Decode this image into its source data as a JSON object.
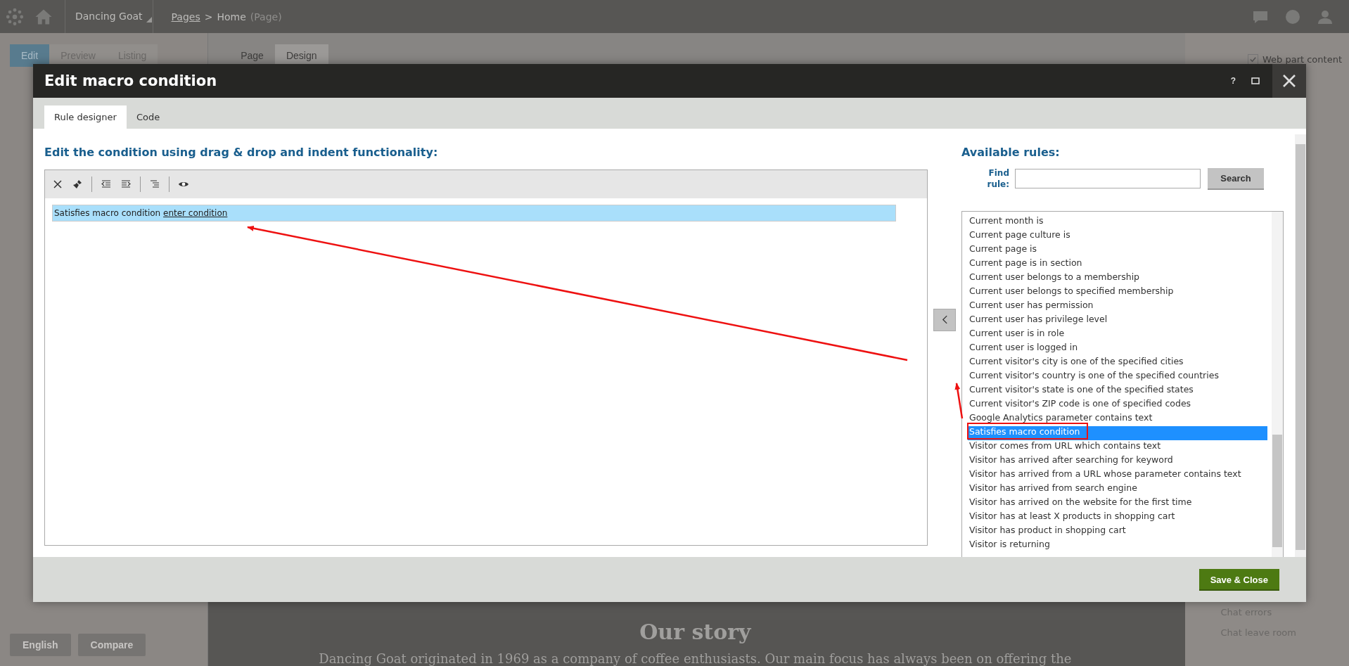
{
  "top_bar": {
    "site": "Dancing Goat",
    "breadcrumb_link": "Pages",
    "breadcrumb_separator": ">",
    "page": "Home",
    "page_type": "(Page)"
  },
  "view_tabs": [
    {
      "label": "Edit",
      "selected": true
    },
    {
      "label": "Preview",
      "selected": false
    },
    {
      "label": "Listing",
      "selected": false
    }
  ],
  "page_tabs": [
    {
      "label": "Page",
      "selected": false
    },
    {
      "label": "Design",
      "selected": true
    }
  ],
  "web_part_content": {
    "label": "Web part content",
    "checked": true
  },
  "language_button": "English",
  "compare_button": "Compare",
  "page_content": {
    "heading": "Our story",
    "paragraph": "Dancing Goat originated in 1969 as a company of coffee enthusiasts. Our main focus has always been on offering the"
  },
  "chat_menu": [
    "Chat errors",
    "Chat leave room"
  ],
  "dialog": {
    "title": "Edit macro condition",
    "help": "?",
    "tabs": [
      {
        "label": "Rule designer",
        "selected": true
      },
      {
        "label": "Code",
        "selected": false
      }
    ],
    "editor_heading": "Edit the condition using drag & drop and indent functionality:",
    "condition": {
      "text": "Satisfies macro condition",
      "link": "enter condition",
      "selected": true
    },
    "rules_heading": "Available rules:",
    "find_label": "Find rule:",
    "search_button": "Search",
    "rules": [
      {
        "label": "Current month is",
        "selected": false
      },
      {
        "label": "Current page culture is",
        "selected": false
      },
      {
        "label": "Current page is",
        "selected": false
      },
      {
        "label": "Current page is in section",
        "selected": false
      },
      {
        "label": "Current user belongs to a membership",
        "selected": false
      },
      {
        "label": "Current user belongs to specified membership",
        "selected": false
      },
      {
        "label": "Current user has permission",
        "selected": false
      },
      {
        "label": "Current user has privilege level",
        "selected": false
      },
      {
        "label": "Current user is in role",
        "selected": false
      },
      {
        "label": "Current user is logged in",
        "selected": false
      },
      {
        "label": "Current visitor's city is one of the specified cities",
        "selected": false
      },
      {
        "label": "Current visitor's country is one of the specified countries",
        "selected": false
      },
      {
        "label": "Current visitor's state is one of the specified states",
        "selected": false
      },
      {
        "label": "Current visitor's ZIP code is one of specified codes",
        "selected": false
      },
      {
        "label": "Google Analytics parameter contains text",
        "selected": false
      },
      {
        "label": "Satisfies macro condition",
        "selected": true
      },
      {
        "label": "Visitor comes from URL which contains text",
        "selected": false
      },
      {
        "label": "Visitor has arrived after searching for keyword",
        "selected": false
      },
      {
        "label": "Visitor has arrived from a URL whose parameter contains text",
        "selected": false
      },
      {
        "label": "Visitor has arrived from search engine",
        "selected": false
      },
      {
        "label": "Visitor has arrived on the website for the first time",
        "selected": false
      },
      {
        "label": "Visitor has at least X products in shopping cart",
        "selected": false
      },
      {
        "label": "Visitor has product in shopping cart",
        "selected": false
      },
      {
        "label": "Visitor is returning",
        "selected": false
      }
    ],
    "save_button": "Save & Close"
  }
}
